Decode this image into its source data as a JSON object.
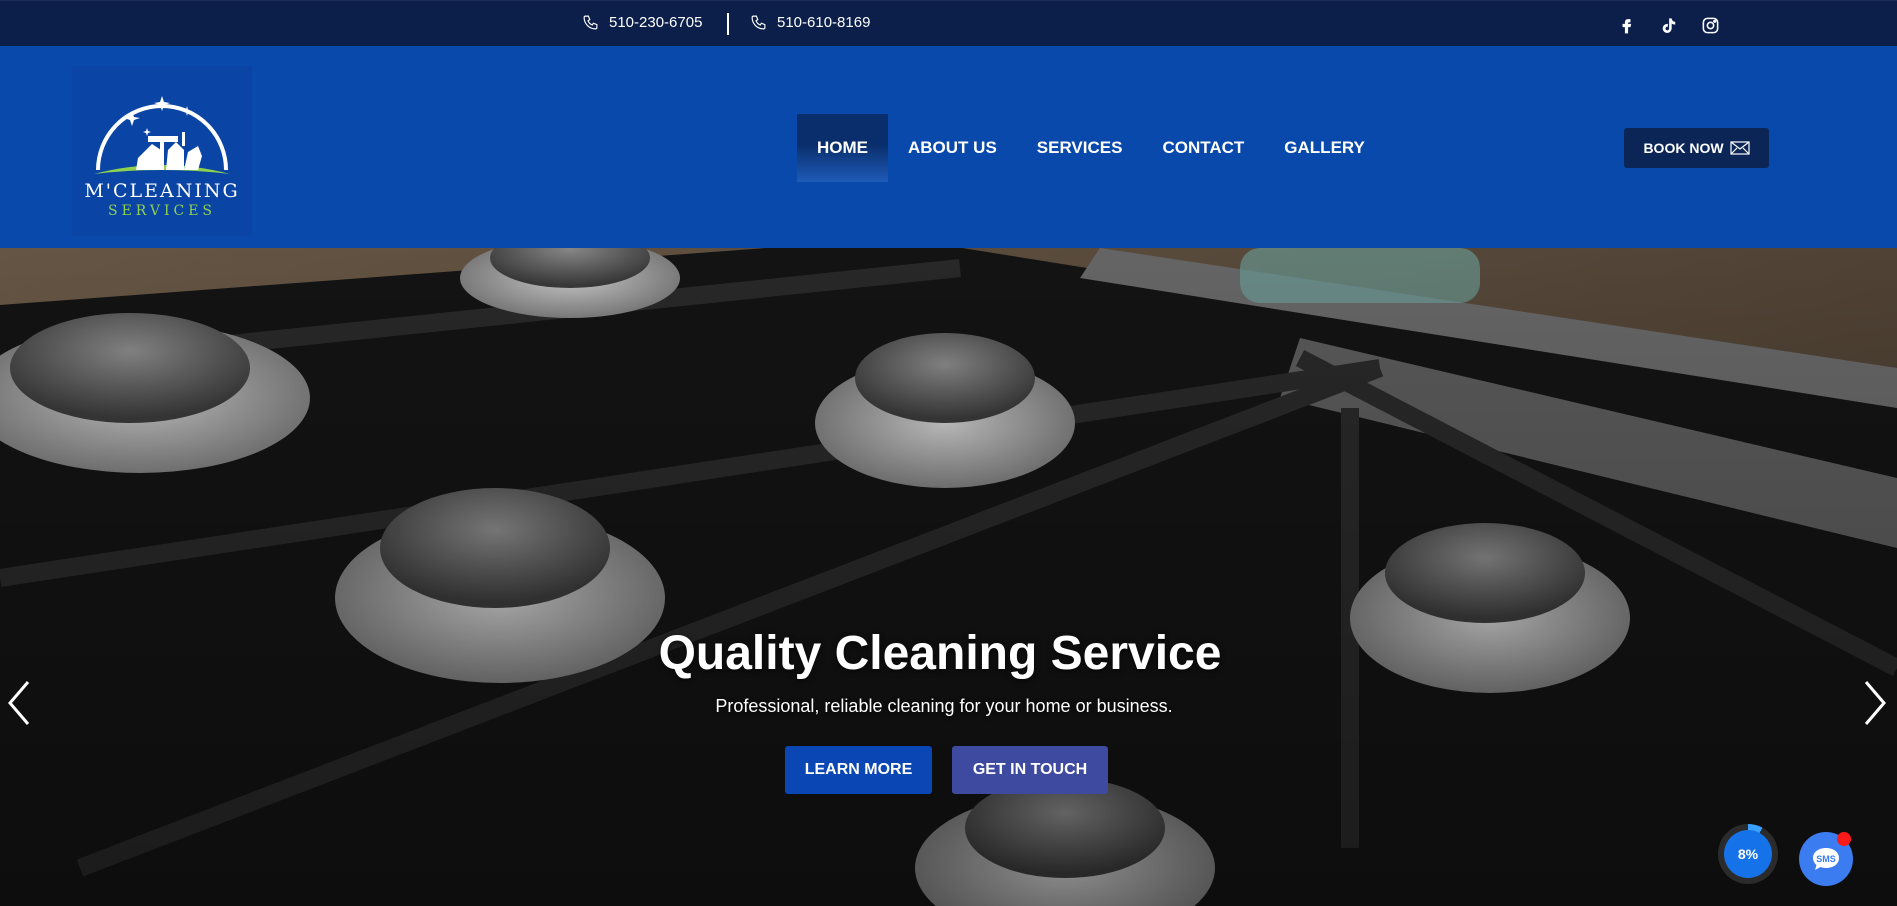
{
  "topbar": {
    "phone1": "510-230-6705",
    "phone2": "510-610-8169",
    "social": [
      "facebook-icon",
      "tiktok-icon",
      "instagram-icon"
    ]
  },
  "logo": {
    "line1": "M'CLEANING",
    "line2": "SERVICES"
  },
  "nav": {
    "items": [
      {
        "label": "HOME",
        "active": true
      },
      {
        "label": "ABOUT US"
      },
      {
        "label": "SERVICES"
      },
      {
        "label": "CONTACT"
      },
      {
        "label": "GALLERY"
      }
    ],
    "book_label": "BOOK NOW"
  },
  "hero": {
    "title": "Quality Cleaning Service",
    "subtitle": "Professional, reliable cleaning for your home or business.",
    "learn_label": "LEARN MORE",
    "touch_label": "GET IN TOUCH"
  },
  "widgets": {
    "progress_label": "8%",
    "progress_value": 0.08,
    "sms_label": "SMS"
  },
  "colors": {
    "topbar": "#0b1f4a",
    "header": "#0849ab",
    "book_button": "#0b2656",
    "learn_button": "#0a46b4",
    "touch_button": "#3e4aa0",
    "logo_green": "#8fd14f"
  }
}
